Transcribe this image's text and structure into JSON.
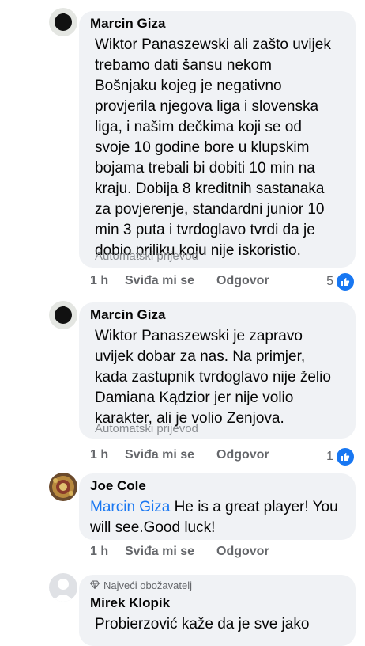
{
  "comments": [
    {
      "author": "Marcin Giza",
      "lines": [
        "Wiktor Panaszewski ali zašto uvijek",
        "trebamo dati šansu nekom",
        "Bošnjaku kojeg je negativno",
        "provjerila njegova liga i slovenska",
        "liga, i našim dečkima koji se od",
        "svoje 10 godine bore u klupskim",
        "bojama trebali bi dobiti 10 min na",
        "kraju. Dobija 8 kreditnih sastanaka",
        "za povjerenje, standardni junior 10",
        "min 3 puta i tvrdoglavo tvrdi da je",
        "dobio priliku koju nije iskoristio."
      ],
      "translation": "Automatski prijevod",
      "time": "1 h",
      "like_label": "Sviđa mi se",
      "reply_label": "Odgovor",
      "reaction_count": "5"
    },
    {
      "author": "Marcin Giza",
      "lines": [
        "Wiktor Panaszewski je zapravo",
        "uvijek dobar za nas. Na primjer,",
        "kada zastupnik tvrdoglavo nije želio",
        "Damiana Kądzior jer nije volio",
        "karakter, ali je volio Zenjova."
      ],
      "translation": "Automatski prijevod",
      "time": "1 h",
      "like_label": "Sviđa mi se",
      "reply_label": "Odgovor",
      "reaction_count": "1"
    },
    {
      "author": "Joe Cole",
      "mention": "Marcin Giza",
      "line1_rest": " He is a great player! You",
      "line2": "will see.Good luck!",
      "time": "1 h",
      "like_label": "Sviđa mi se",
      "reply_label": "Odgovor"
    },
    {
      "badge": "Najveći obožavatelj",
      "author": "Mirek Klopik",
      "line1": "Probierzović kaže da je sve jako"
    }
  ],
  "icons": {
    "like": "thumbs-up-icon",
    "badge": "diamond-icon"
  },
  "colors": {
    "bubble": "#f0f2f5",
    "accent": "#1877f2",
    "secondary_text": "#65676b"
  }
}
